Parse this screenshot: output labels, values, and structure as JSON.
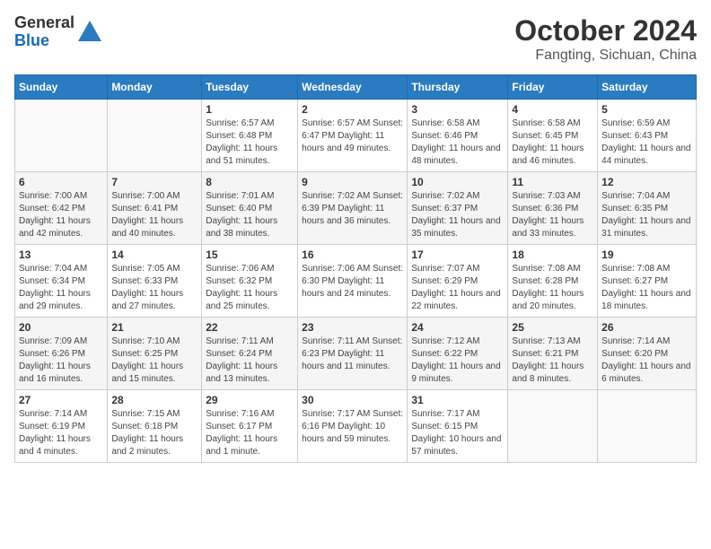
{
  "header": {
    "logo_general": "General",
    "logo_blue": "Blue",
    "month_title": "October 2024",
    "location": "Fangting, Sichuan, China"
  },
  "columns": [
    "Sunday",
    "Monday",
    "Tuesday",
    "Wednesday",
    "Thursday",
    "Friday",
    "Saturday"
  ],
  "weeks": [
    [
      {
        "day": "",
        "info": ""
      },
      {
        "day": "",
        "info": ""
      },
      {
        "day": "1",
        "info": "Sunrise: 6:57 AM\nSunset: 6:48 PM\nDaylight: 11 hours and 51 minutes."
      },
      {
        "day": "2",
        "info": "Sunrise: 6:57 AM\nSunset: 6:47 PM\nDaylight: 11 hours and 49 minutes."
      },
      {
        "day": "3",
        "info": "Sunrise: 6:58 AM\nSunset: 6:46 PM\nDaylight: 11 hours and 48 minutes."
      },
      {
        "day": "4",
        "info": "Sunrise: 6:58 AM\nSunset: 6:45 PM\nDaylight: 11 hours and 46 minutes."
      },
      {
        "day": "5",
        "info": "Sunrise: 6:59 AM\nSunset: 6:43 PM\nDaylight: 11 hours and 44 minutes."
      }
    ],
    [
      {
        "day": "6",
        "info": "Sunrise: 7:00 AM\nSunset: 6:42 PM\nDaylight: 11 hours and 42 minutes."
      },
      {
        "day": "7",
        "info": "Sunrise: 7:00 AM\nSunset: 6:41 PM\nDaylight: 11 hours and 40 minutes."
      },
      {
        "day": "8",
        "info": "Sunrise: 7:01 AM\nSunset: 6:40 PM\nDaylight: 11 hours and 38 minutes."
      },
      {
        "day": "9",
        "info": "Sunrise: 7:02 AM\nSunset: 6:39 PM\nDaylight: 11 hours and 36 minutes."
      },
      {
        "day": "10",
        "info": "Sunrise: 7:02 AM\nSunset: 6:37 PM\nDaylight: 11 hours and 35 minutes."
      },
      {
        "day": "11",
        "info": "Sunrise: 7:03 AM\nSunset: 6:36 PM\nDaylight: 11 hours and 33 minutes."
      },
      {
        "day": "12",
        "info": "Sunrise: 7:04 AM\nSunset: 6:35 PM\nDaylight: 11 hours and 31 minutes."
      }
    ],
    [
      {
        "day": "13",
        "info": "Sunrise: 7:04 AM\nSunset: 6:34 PM\nDaylight: 11 hours and 29 minutes."
      },
      {
        "day": "14",
        "info": "Sunrise: 7:05 AM\nSunset: 6:33 PM\nDaylight: 11 hours and 27 minutes."
      },
      {
        "day": "15",
        "info": "Sunrise: 7:06 AM\nSunset: 6:32 PM\nDaylight: 11 hours and 25 minutes."
      },
      {
        "day": "16",
        "info": "Sunrise: 7:06 AM\nSunset: 6:30 PM\nDaylight: 11 hours and 24 minutes."
      },
      {
        "day": "17",
        "info": "Sunrise: 7:07 AM\nSunset: 6:29 PM\nDaylight: 11 hours and 22 minutes."
      },
      {
        "day": "18",
        "info": "Sunrise: 7:08 AM\nSunset: 6:28 PM\nDaylight: 11 hours and 20 minutes."
      },
      {
        "day": "19",
        "info": "Sunrise: 7:08 AM\nSunset: 6:27 PM\nDaylight: 11 hours and 18 minutes."
      }
    ],
    [
      {
        "day": "20",
        "info": "Sunrise: 7:09 AM\nSunset: 6:26 PM\nDaylight: 11 hours and 16 minutes."
      },
      {
        "day": "21",
        "info": "Sunrise: 7:10 AM\nSunset: 6:25 PM\nDaylight: 11 hours and 15 minutes."
      },
      {
        "day": "22",
        "info": "Sunrise: 7:11 AM\nSunset: 6:24 PM\nDaylight: 11 hours and 13 minutes."
      },
      {
        "day": "23",
        "info": "Sunrise: 7:11 AM\nSunset: 6:23 PM\nDaylight: 11 hours and 11 minutes."
      },
      {
        "day": "24",
        "info": "Sunrise: 7:12 AM\nSunset: 6:22 PM\nDaylight: 11 hours and 9 minutes."
      },
      {
        "day": "25",
        "info": "Sunrise: 7:13 AM\nSunset: 6:21 PM\nDaylight: 11 hours and 8 minutes."
      },
      {
        "day": "26",
        "info": "Sunrise: 7:14 AM\nSunset: 6:20 PM\nDaylight: 11 hours and 6 minutes."
      }
    ],
    [
      {
        "day": "27",
        "info": "Sunrise: 7:14 AM\nSunset: 6:19 PM\nDaylight: 11 hours and 4 minutes."
      },
      {
        "day": "28",
        "info": "Sunrise: 7:15 AM\nSunset: 6:18 PM\nDaylight: 11 hours and 2 minutes."
      },
      {
        "day": "29",
        "info": "Sunrise: 7:16 AM\nSunset: 6:17 PM\nDaylight: 11 hours and 1 minute."
      },
      {
        "day": "30",
        "info": "Sunrise: 7:17 AM\nSunset: 6:16 PM\nDaylight: 10 hours and 59 minutes."
      },
      {
        "day": "31",
        "info": "Sunrise: 7:17 AM\nSunset: 6:15 PM\nDaylight: 10 hours and 57 minutes."
      },
      {
        "day": "",
        "info": ""
      },
      {
        "day": "",
        "info": ""
      }
    ]
  ]
}
